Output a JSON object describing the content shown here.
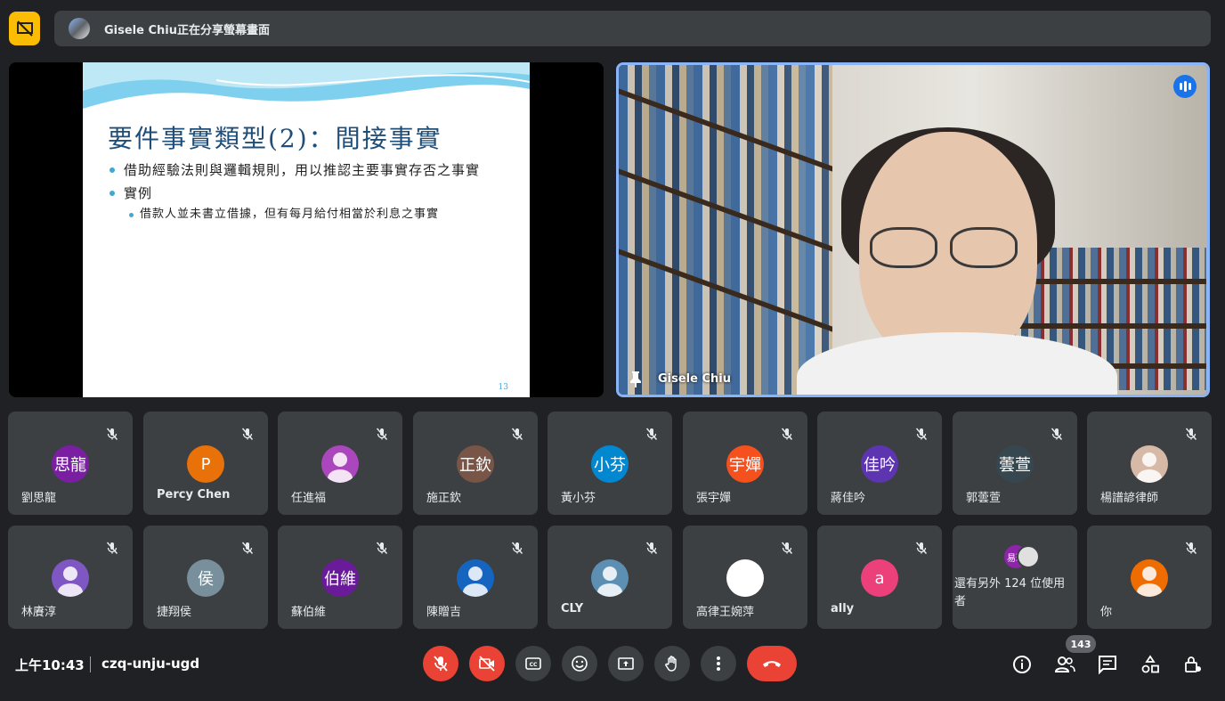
{
  "banner": {
    "text": "Gisele Chiu正在分享螢幕畫面"
  },
  "slide": {
    "title": "要件事實類型(2)：間接事實",
    "bullet1": "借助經驗法則與邏輯規則，用以推認主要事實存否之事實",
    "bullet2": "實例",
    "sub_bullet": "借款人並未書立借據，但有每月給付相當於利息之事實",
    "page_number": "13"
  },
  "speaker": {
    "name": "Gisele Chiu"
  },
  "participants": [
    {
      "name": "劉思龍",
      "initials": "思龍",
      "color": "#7b1fa2"
    },
    {
      "name": "Percy Chen",
      "initials": "P",
      "color": "#e8710a"
    },
    {
      "name": "任進福",
      "initials": "",
      "color": "#ab47bc"
    },
    {
      "name": "施正欽",
      "initials": "正欽",
      "color": "#795548"
    },
    {
      "name": "黃小芬",
      "initials": "小芬",
      "color": "#0288d1"
    },
    {
      "name": "張宇嬋",
      "initials": "宇嬋",
      "color": "#f4511e"
    },
    {
      "name": "蔣佳吟",
      "initials": "佳吟",
      "color": "#5e35b1"
    },
    {
      "name": "郭蕓萱",
      "initials": "蕓萱",
      "color": "#37474f"
    },
    {
      "name": "楊譜諺律師",
      "initials": "",
      "color": "#d7b9a8"
    },
    {
      "name": "林賡淳",
      "initials": "",
      "color": "#7e57c2"
    },
    {
      "name": "捷翔侯",
      "initials": "侯",
      "color": "#78909c"
    },
    {
      "name": "蘇伯維",
      "initials": "伯維",
      "color": "#6a1b9a"
    },
    {
      "name": "陳贈吉",
      "initials": "",
      "color": "#1565c0"
    },
    {
      "name": "CLY",
      "initials": "",
      "color": "#5d8fb3"
    },
    {
      "name": "高律王婉萍",
      "initials": "",
      "color": "#ffffff"
    },
    {
      "name": "ally",
      "initials": "a",
      "color": "#ec407a"
    },
    {
      "name": "還有另外 124 位使用者",
      "initials": "易玹",
      "color": "#8e24aa"
    },
    {
      "name": "你",
      "initials": "",
      "color": "#ef6c00"
    }
  ],
  "bottom": {
    "time": "上午10:43",
    "meeting_code": "czq-unju-ugd",
    "participant_count": "143"
  },
  "colors": {
    "accent_blue": "#8ab4f8",
    "end_red": "#ea4335",
    "present_yellow": "#fbbc04"
  }
}
